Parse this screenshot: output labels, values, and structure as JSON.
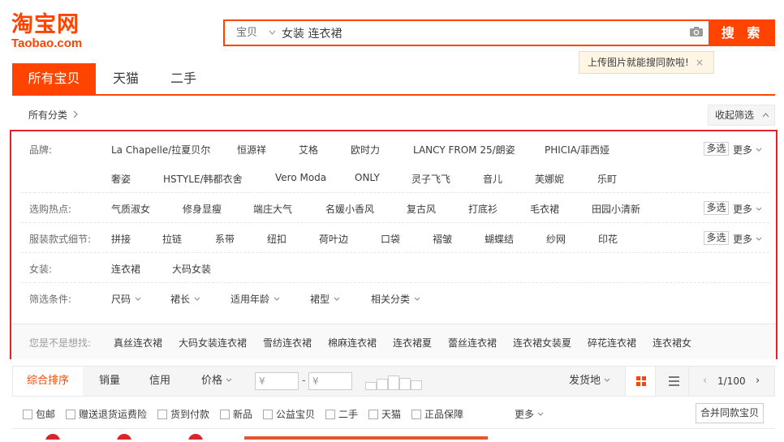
{
  "logo": {
    "line1": "淘宝网",
    "line2": "Taobao.com",
    "color": "#ff4400"
  },
  "search": {
    "category": "宝贝",
    "query": "女装 连衣裙",
    "button_label": "搜 索",
    "tip": "上传图片就能搜同款啦!",
    "tip_close": "×"
  },
  "tabs": [
    {
      "label": "所有宝贝",
      "active": true
    },
    {
      "label": "天猫",
      "active": false
    },
    {
      "label": "二手",
      "active": false
    }
  ],
  "categories": {
    "all_label": "所有分类",
    "chevron": "›",
    "collapse_label": "收起筛选",
    "collapse_chevron": "^"
  },
  "filters": {
    "brand": {
      "label": "品牌:",
      "row1": [
        "La Chapelle/拉夏贝尔",
        "恒源祥",
        "艾格",
        "欧时力",
        "LANCY FROM 25/朗姿",
        "PHICIA/菲西娅"
      ],
      "row2": [
        "奢姿",
        "HSTYLE/韩都衣舍",
        "Vero Moda",
        "ONLY",
        "灵子飞飞",
        "音儿",
        "芙娜妮",
        "乐町"
      ],
      "multi": "多选",
      "more": "更多"
    },
    "hot": {
      "label": "选购热点:",
      "items": [
        "气质淑女",
        "修身显瘦",
        "端庄大气",
        "名媛小香风",
        "复古风",
        "打底衫",
        "毛衣裙",
        "田园小清新"
      ],
      "multi": "多选",
      "more": "更多"
    },
    "detail": {
      "label": "服装款式细节:",
      "items": [
        "拼接",
        "拉链",
        "系带",
        "纽扣",
        "荷叶边",
        "口袋",
        "褶皱",
        "蝴蝶结",
        "纱网",
        "印花"
      ],
      "multi": "多选",
      "more": "更多"
    },
    "women": {
      "label": "女装:",
      "items": [
        "连衣裙",
        "大码女装"
      ]
    },
    "conditions": {
      "label": "筛选条件:",
      "items": [
        "尺码",
        "裙长",
        "适用年龄",
        "裙型",
        "相关分类"
      ]
    },
    "suggest": {
      "label": "您是不是想找:",
      "items": [
        "真丝连衣裙",
        "大码女装连衣裙",
        "雪纺连衣裙",
        "棉麻连衣裙",
        "连衣裙夏",
        "蕾丝连衣裙",
        "连衣裙女装夏",
        "碎花连衣裙",
        "连衣裙女"
      ]
    }
  },
  "sortbar": {
    "items": [
      "综合排序",
      "销量",
      "信用",
      "价格"
    ],
    "price_min_placeholder": "¥",
    "price_dash": "-",
    "price_max_placeholder": "¥",
    "location": "发货地",
    "page": "1/100",
    "prev": "‹",
    "next": "›"
  },
  "checkboxes": [
    "包邮",
    "赠送退货运费险",
    "货到付款",
    "新品",
    "公益宝贝",
    "二手",
    "天猫",
    "正品保障"
  ],
  "more_label": "更多",
  "merge_label": "合并同款宝贝",
  "colors": {
    "accent": "#ff4400",
    "highlight_border": "#d8262b"
  }
}
